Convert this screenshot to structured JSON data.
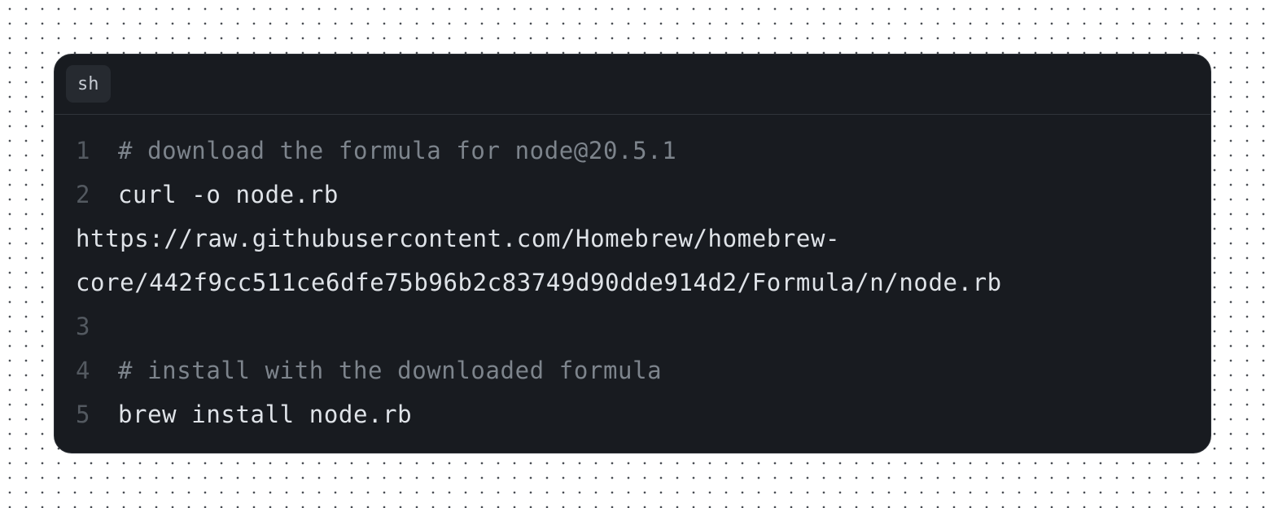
{
  "code_block": {
    "language": "sh",
    "lines": [
      {
        "num": "1",
        "text": "# download the formula for node@20.5.1",
        "kind": "comment"
      },
      {
        "num": "2",
        "text": "curl -o node.rb",
        "kind": "code"
      },
      {
        "text": "https://raw.githubusercontent.com/Homebrew/homebrew-",
        "kind": "wrap"
      },
      {
        "text": "core/442f9cc511ce6dfe75b96b2c83749d90dde914d2/Formula/n/node.rb",
        "kind": "wrap"
      },
      {
        "num": "3",
        "text": "",
        "kind": "code"
      },
      {
        "num": "4",
        "text": "# install with the downloaded formula",
        "kind": "comment"
      },
      {
        "num": "5",
        "text": "brew install node.rb",
        "kind": "code"
      }
    ]
  },
  "colors": {
    "card_background": "#181b20",
    "comment_text": "#7d848c",
    "code_text": "#dfe3e8",
    "line_number": "#535960"
  }
}
